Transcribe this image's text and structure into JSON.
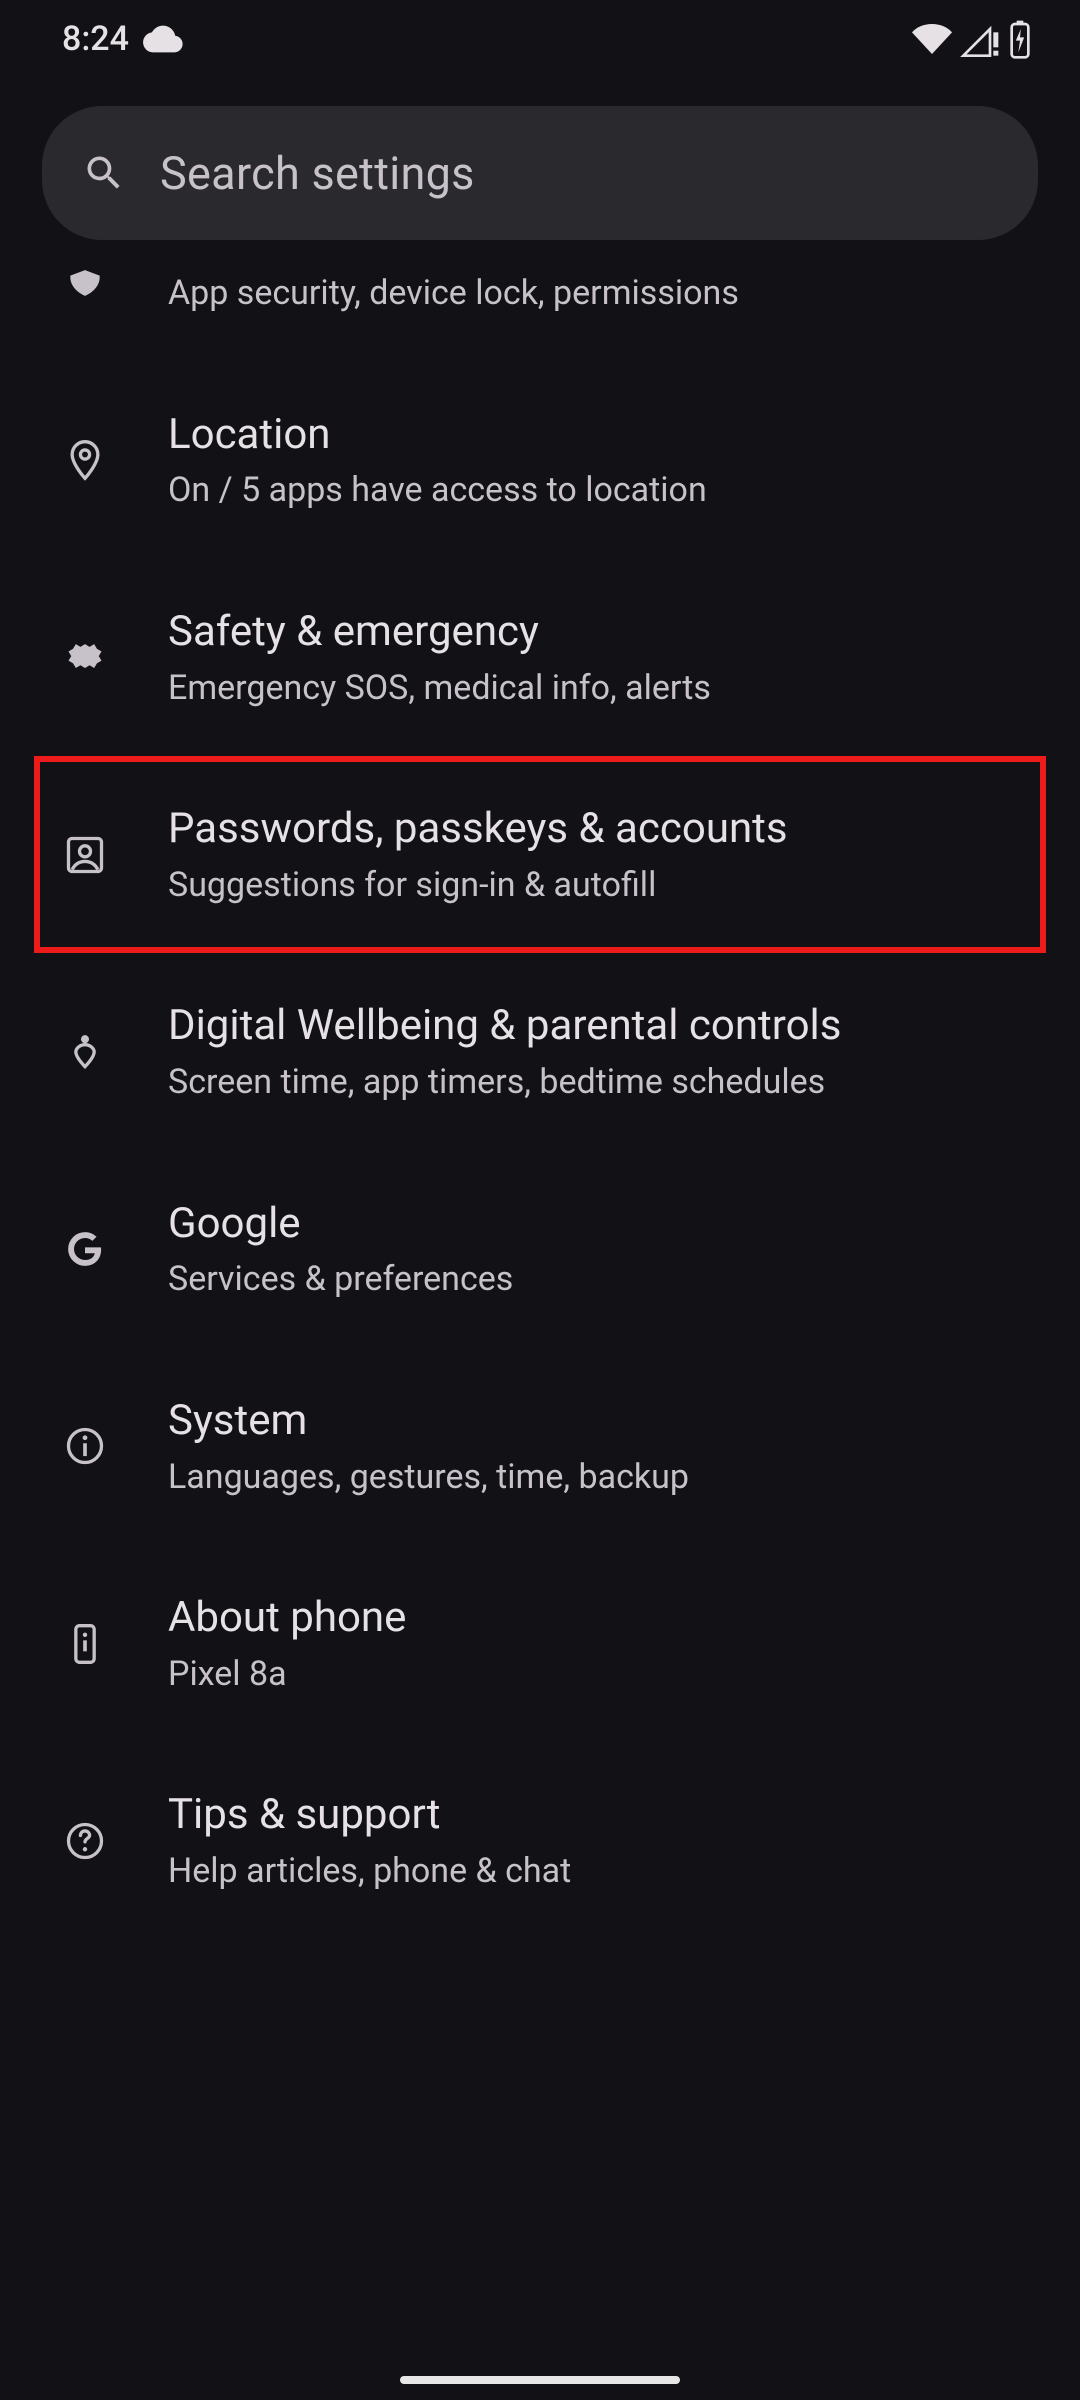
{
  "status_bar": {
    "time": "8:24"
  },
  "search": {
    "placeholder": "Search settings"
  },
  "partial_row": {
    "subtitle": "App security, device lock, permissions"
  },
  "items": [
    {
      "title": "Location",
      "subtitle": "On / 5 apps have access to location"
    },
    {
      "title": "Safety & emergency",
      "subtitle": "Emergency SOS, medical info, alerts"
    },
    {
      "title": "Passwords, passkeys & accounts",
      "subtitle": "Suggestions for sign-in & autofill"
    },
    {
      "title": "Digital Wellbeing & parental controls",
      "subtitle": "Screen time, app timers, bedtime schedules"
    },
    {
      "title": "Google",
      "subtitle": "Services & preferences"
    },
    {
      "title": "System",
      "subtitle": "Languages, gestures, time, backup"
    },
    {
      "title": "About phone",
      "subtitle": "Pixel 8a"
    },
    {
      "title": "Tips & support",
      "subtitle": "Help articles, phone & chat"
    }
  ]
}
